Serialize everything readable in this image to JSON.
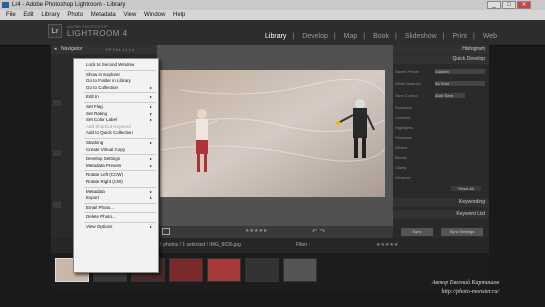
{
  "window": {
    "title": "Lr4 - Adobe Photoshop Lightroom - Library",
    "min": "_",
    "max": "□",
    "close": "✕"
  },
  "menubar": [
    "File",
    "Edit",
    "Library",
    "Photo",
    "Metadata",
    "View",
    "Window",
    "Help"
  ],
  "identity": {
    "badge": "Lr",
    "subtitle": "ADOBE PHOTOSHOP",
    "name": "LIGHTROOM 4"
  },
  "modules": [
    "Library",
    "Develop",
    "Map",
    "Book",
    "Slideshow",
    "Print",
    "Web"
  ],
  "active_module": "Library",
  "left_panel": {
    "navigator": "Navigator",
    "zoom": "FIT  FILL  1:1  1:4"
  },
  "right_panel": {
    "histogram": "Histogram",
    "quick_develop": "Quick Develop",
    "saved_preset_label": "Saved Preset",
    "saved_preset_value": "Custom",
    "white_balance_label": "White Balance",
    "white_balance_value": "As Shot",
    "tone_control_label": "Tone Control",
    "tone_control_value": "Auto Tone",
    "rows": [
      "Exposure",
      "Contrast",
      "Highlights",
      "Shadows",
      "Whites",
      "Blacks",
      "Clarity",
      "Vibrance"
    ],
    "reset_all": "Reset All",
    "keywording": "Keywording",
    "keyword_list": "Keyword List",
    "sync": "Sync",
    "sync_settings": "Sync Settings"
  },
  "filmbar": {
    "info": "7 photos / 1 selected / IMG_9636.jpg",
    "filter_label": "Filter :"
  },
  "context_menu": [
    {
      "label": "Lock to Second Window",
      "arrow": false,
      "disabled": false
    },
    {
      "sep": true
    },
    {
      "label": "Show in Explorer",
      "arrow": false,
      "disabled": false
    },
    {
      "label": "Go to Folder in Library",
      "arrow": false,
      "disabled": false
    },
    {
      "label": "Go to Collection",
      "arrow": true,
      "disabled": false
    },
    {
      "sep": true
    },
    {
      "label": "Edit In",
      "arrow": true,
      "disabled": false
    },
    {
      "sep": true
    },
    {
      "label": "Set Flag",
      "arrow": true,
      "disabled": false
    },
    {
      "label": "Set Rating",
      "arrow": true,
      "disabled": false
    },
    {
      "label": "Set Color Label",
      "arrow": true,
      "disabled": false
    },
    {
      "label": "Add Shortcut Keyword",
      "arrow": false,
      "disabled": true
    },
    {
      "label": "Add to Quick Collection",
      "arrow": false,
      "disabled": false
    },
    {
      "sep": true
    },
    {
      "label": "Stacking",
      "arrow": true,
      "disabled": false
    },
    {
      "label": "Create Virtual Copy",
      "arrow": false,
      "disabled": false
    },
    {
      "sep": true
    },
    {
      "label": "Develop Settings",
      "arrow": true,
      "disabled": false
    },
    {
      "label": "Metadata Presets",
      "arrow": true,
      "disabled": false
    },
    {
      "sep": true
    },
    {
      "label": "Rotate Left (CCW)",
      "arrow": false,
      "disabled": false
    },
    {
      "label": "Rotate Right (CW)",
      "arrow": false,
      "disabled": false
    },
    {
      "sep": true
    },
    {
      "label": "Metadata",
      "arrow": true,
      "disabled": false
    },
    {
      "label": "Export",
      "arrow": true,
      "disabled": false
    },
    {
      "sep": true
    },
    {
      "label": "Email Photo...",
      "arrow": false,
      "disabled": false
    },
    {
      "sep": true
    },
    {
      "label": "Delete Photo...",
      "arrow": false,
      "disabled": false
    },
    {
      "sep": true
    },
    {
      "label": "View Options",
      "arrow": true,
      "disabled": false
    }
  ],
  "credit": {
    "line1": "Автор Евгений Карташов",
    "line2": "http://photo-monster.ru/"
  },
  "colors": {
    "accent": "#ffffff",
    "menu_bg": "#f2f2f2",
    "panel_bg": "#2a2a2a"
  }
}
